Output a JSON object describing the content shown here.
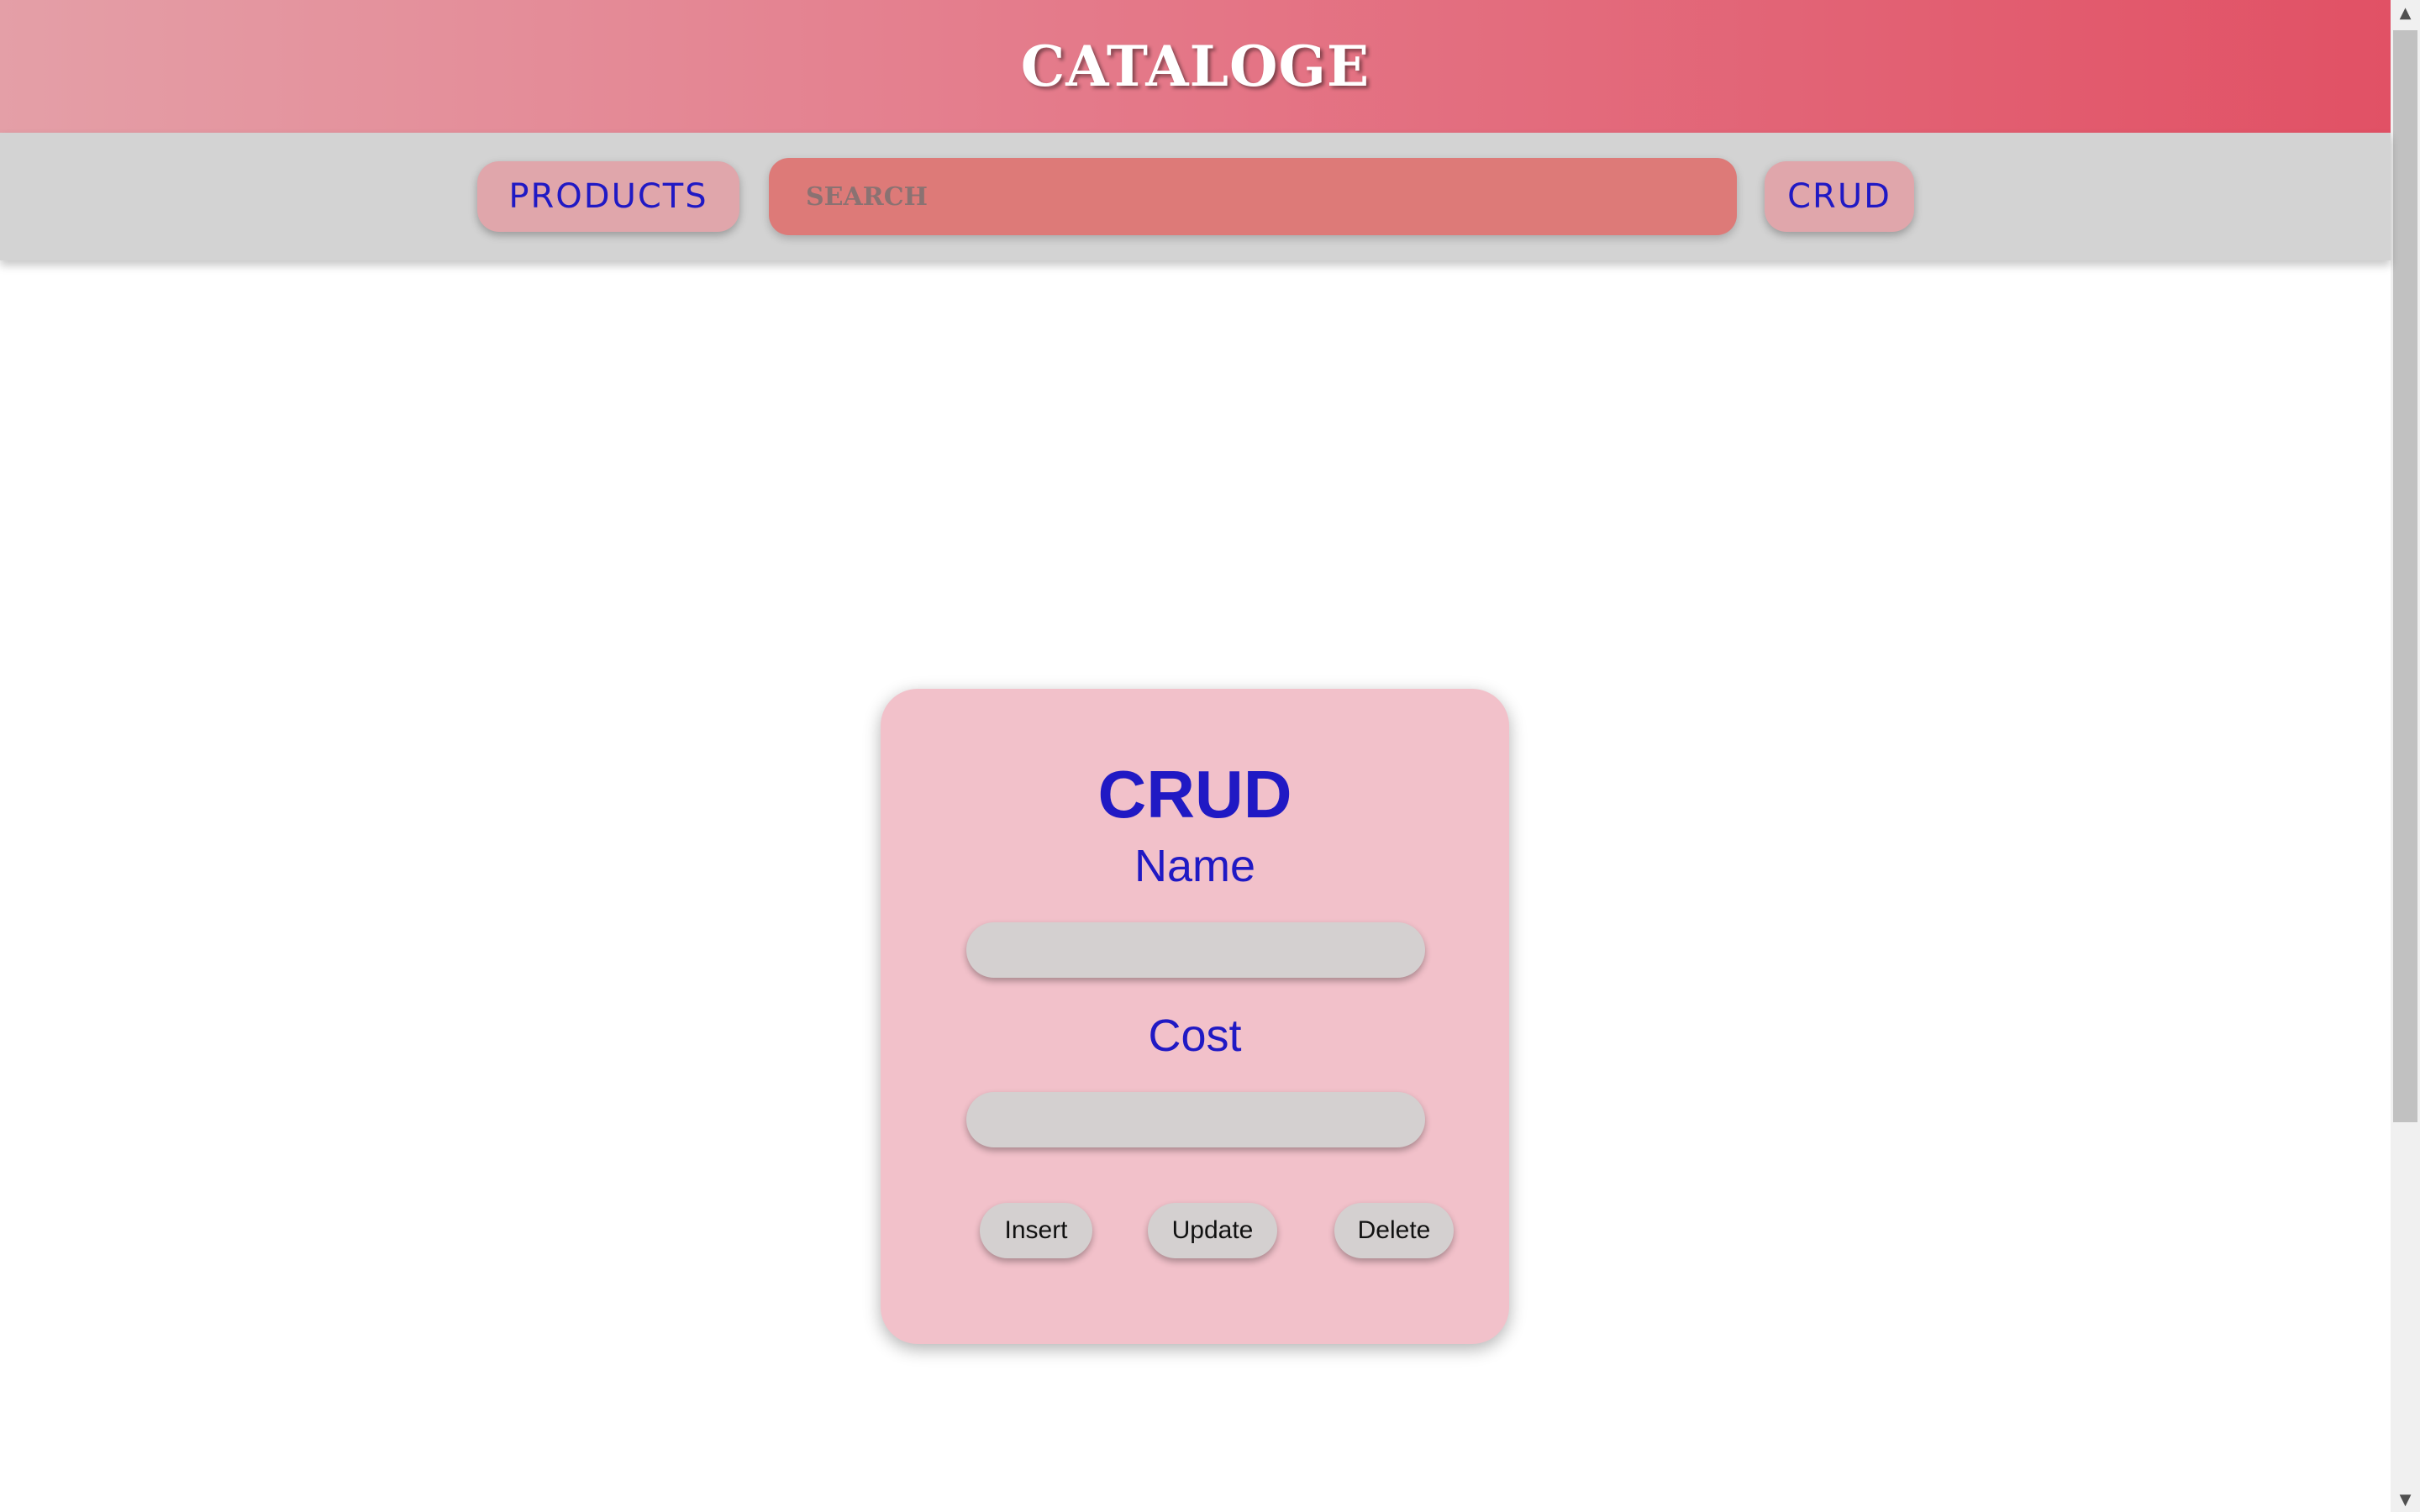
{
  "header": {
    "brand": "CATALOGE"
  },
  "nav": {
    "products_label": "PRODUCTS",
    "search_placeholder": "SEARCH",
    "search_value": "",
    "crud_label": "CRUD"
  },
  "form": {
    "title": "CRUD",
    "name_label": "Name",
    "name_value": "",
    "cost_label": "Cost",
    "cost_value": "",
    "buttons": {
      "insert": "Insert",
      "update": "Update",
      "delete": "Delete"
    }
  },
  "scrollbar": {
    "up_icon": "▲",
    "down_icon": "▼"
  },
  "colors": {
    "header_gradient_start": "#e49fa7",
    "header_gradient_end": "#e15165",
    "nav_text": "#2019c4",
    "search_bg": "#dd7a78",
    "card_bg": "#f2c1ca",
    "field_bg": "#d4d0d0"
  }
}
